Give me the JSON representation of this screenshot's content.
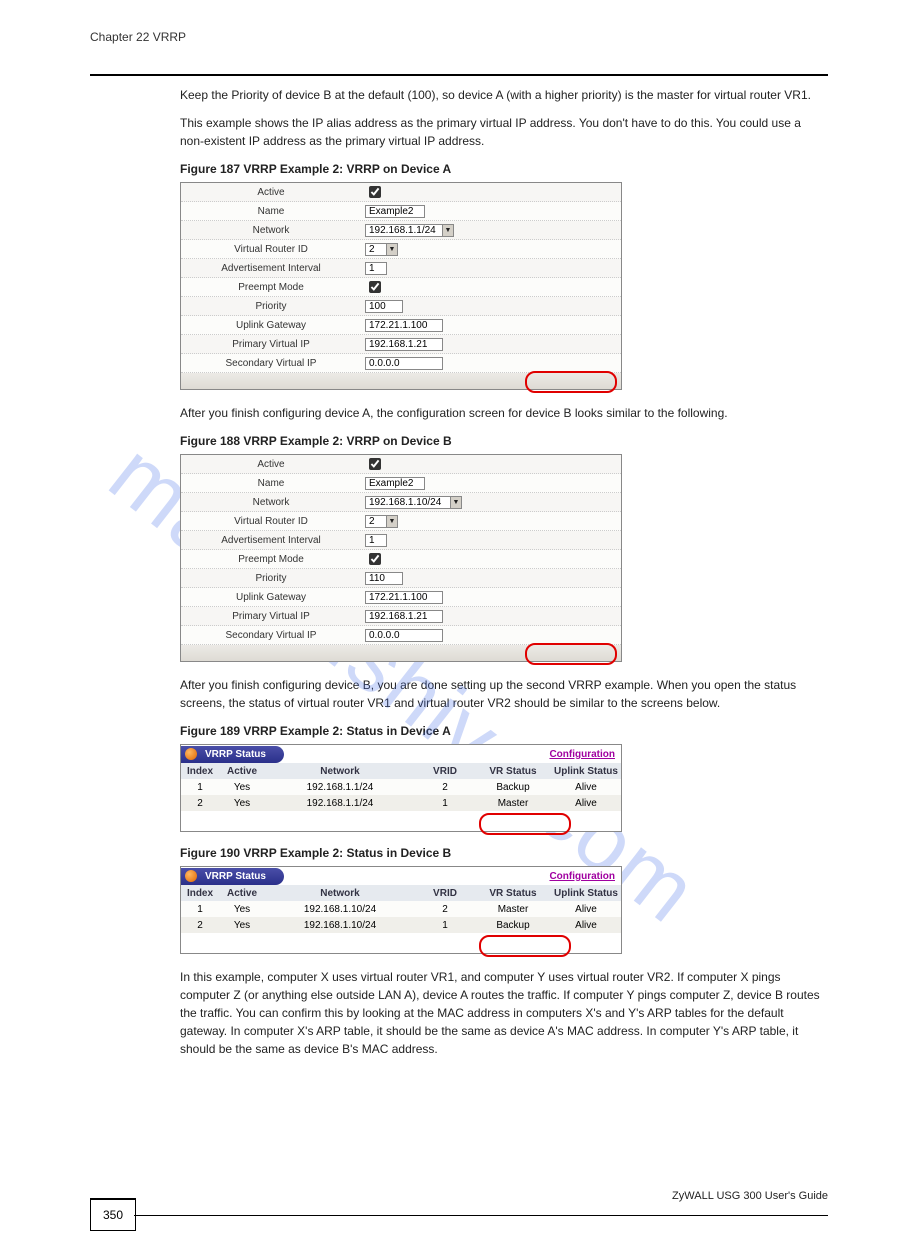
{
  "header": {
    "title": "Chapter 22 VRRP"
  },
  "intro": {
    "p1": "Keep the Priority of device B at the default (100), so device A (with a higher priority) is the master for virtual router VR1.",
    "p2": "This example shows the IP alias address as the primary virtual IP address. You don't have to do this. You could use a non-existent IP address as the primary virtual IP address."
  },
  "fig187": {
    "caption": "Figure 187   VRRP Example 2: VRRP on Device A"
  },
  "panelA": {
    "labels": {
      "active": "Active",
      "name": "Name",
      "network": "Network",
      "vrid": "Virtual Router ID",
      "advint": "Advertisement Interval",
      "preempt": "Preempt Mode",
      "priority": "Priority",
      "uplink": "Uplink Gateway",
      "pvip": "Primary Virtual IP",
      "svip": "Secondary Virtual IP"
    },
    "values": {
      "name": "Example2",
      "network": "192.168.1.1/24",
      "vrid": "2",
      "advint": "1",
      "priority": "100",
      "uplink": "172.21.1.100",
      "pvip": "192.168.1.21",
      "svip": "0.0.0.0"
    }
  },
  "mid1": "After you finish configuring device A, the configuration screen for device B looks similar to the following.",
  "fig188": {
    "caption": "Figure 188   VRRP Example 2: VRRP on Device B"
  },
  "panelB": {
    "values": {
      "name": "Example2",
      "network": "192.168.1.10/24",
      "vrid": "2",
      "advint": "1",
      "priority": "110",
      "uplink": "172.21.1.100",
      "pvip": "192.168.1.21",
      "svip": "0.0.0.0"
    }
  },
  "mid2": "After you finish configuring device B, you are done setting up the second VRRP example. When you open the status screens, the status of virtual router VR1 and virtual router VR2 should be similar to the screens below.",
  "fig189": {
    "caption": "Figure 189   VRRP Example 2: Status in Device A"
  },
  "status": {
    "title": "VRRP Status",
    "conf": "Configuration",
    "cols": {
      "idx": "Index",
      "act": "Active",
      "net": "Network",
      "vrid": "VRID",
      "vrs": "VR Status",
      "up": "Uplink Status"
    }
  },
  "statusA": {
    "rows": [
      {
        "idx": "1",
        "act": "Yes",
        "net": "192.168.1.1/24",
        "vrid": "2",
        "vrs": "Backup",
        "up": "Alive"
      },
      {
        "idx": "2",
        "act": "Yes",
        "net": "192.168.1.1/24",
        "vrid": "1",
        "vrs": "Master",
        "up": "Alive"
      }
    ]
  },
  "fig190": {
    "caption": "Figure 190   VRRP Example 2: Status in Device B"
  },
  "statusB": {
    "rows": [
      {
        "idx": "1",
        "act": "Yes",
        "net": "192.168.1.10/24",
        "vrid": "2",
        "vrs": "Master",
        "up": "Alive"
      },
      {
        "idx": "2",
        "act": "Yes",
        "net": "192.168.1.10/24",
        "vrid": "1",
        "vrs": "Backup",
        "up": "Alive"
      }
    ]
  },
  "outro": "In this example, computer X uses virtual router VR1, and computer Y uses virtual router VR2. If computer X pings computer Z (or anything else outside LAN A), device A routes the traffic. If computer Y pings computer Z, device B routes the traffic. You can confirm this by looking at the MAC address in computers X's and Y's ARP tables for the default gateway. In computer X's ARP table, it should be the same as device A's MAC address. In computer Y's ARP table, it should be the same as device B's MAC address.",
  "footer": {
    "page": "350",
    "manual": "ZyWALL USG 300 User's Guide"
  },
  "watermark": "manualshive.com"
}
